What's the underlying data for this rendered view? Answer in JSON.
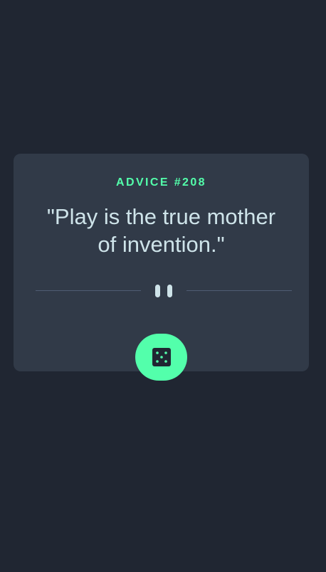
{
  "advice": {
    "label": "ADVICE #208",
    "quote": "\"Play is the true mother of invention.\""
  },
  "divider": {
    "icon": "pause-icon"
  },
  "button": {
    "icon": "dice-icon",
    "accent_color": "#53ffab"
  },
  "colors": {
    "background": "#202632",
    "card": "#313a48",
    "text": "#cee3e9",
    "accent": "#53ffab"
  }
}
